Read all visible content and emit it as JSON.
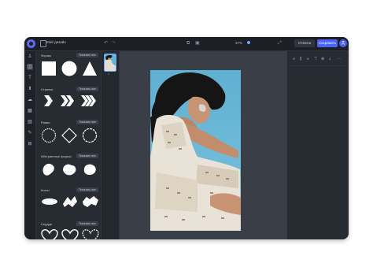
{
  "app": {
    "title": "Мой дизайн",
    "zoom": "37%",
    "share_label": "Отмена",
    "save_label": "Сохранить",
    "avatar_initial": "Д"
  },
  "colors": {
    "accent": "#4a63f5",
    "selection": "#6ea6ff",
    "window_bg": "#23272e"
  },
  "rail_icons": [
    "shapes-icon",
    "elements-icon",
    "text-icon",
    "upload-icon",
    "cloud-icon",
    "grid-icon",
    "photo-icon",
    "draw-icon",
    "apps-icon"
  ],
  "panel": {
    "show_all_label": "Показать все",
    "sections": [
      {
        "title": "Формы"
      },
      {
        "title": "Стрелки"
      },
      {
        "title": "Рамки"
      },
      {
        "title": "Абстрактные формы"
      },
      {
        "title": "Кисти"
      },
      {
        "title": "Сердце"
      }
    ]
  },
  "pages": {
    "current_page_number": "1"
  },
  "right_panel": {
    "align_icons": [
      "align-left-icon",
      "align-center-icon",
      "align-right-icon",
      "align-top-icon",
      "align-middle-icon",
      "align-bottom-icon",
      "more-icon"
    ]
  }
}
